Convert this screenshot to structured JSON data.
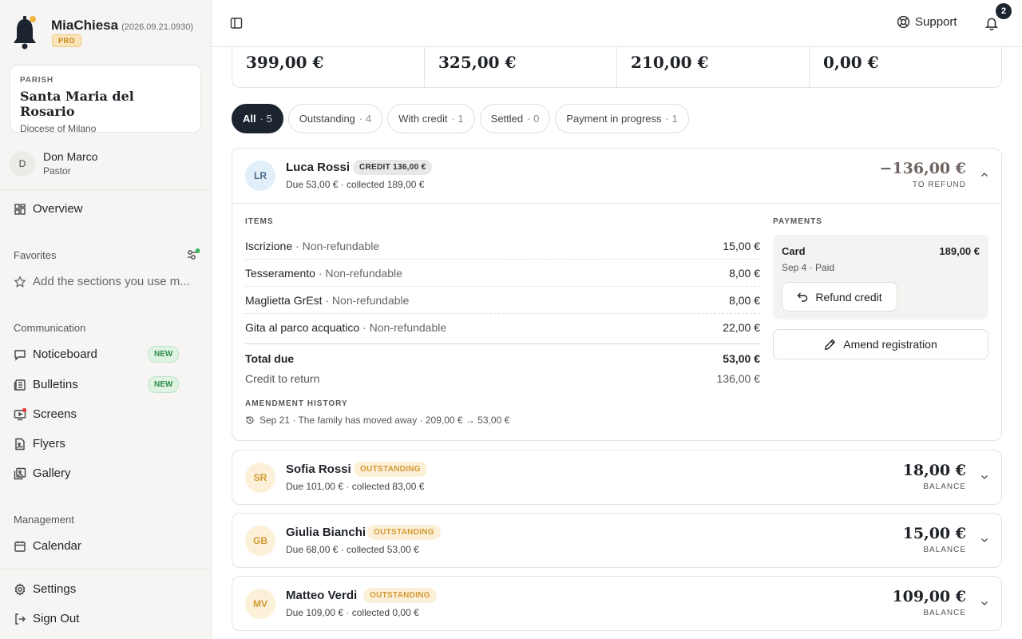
{
  "app": {
    "name": "MiaChiesa",
    "version": "(2026.09.21.0930)",
    "plan": "PRO"
  },
  "parish": {
    "label": "PARISH",
    "name": "Santa Maria del Rosario",
    "diocese": "Diocese of Milano"
  },
  "user": {
    "initial": "D",
    "name": "Don Marco",
    "role": "Pastor"
  },
  "nav": {
    "overview": "Overview",
    "favorites_title": "Favorites",
    "favorites_hint": "Add the sections you use m...",
    "communication_title": "Communication",
    "noticeboard": "Noticeboard",
    "bulletins": "Bulletins",
    "screens": "Screens",
    "flyers": "Flyers",
    "gallery": "Gallery",
    "new_badge": "NEW",
    "management_title": "Management",
    "calendar": "Calendar",
    "settings": "Settings",
    "sign_out": "Sign Out"
  },
  "topbar": {
    "support": "Support",
    "notifications": "2"
  },
  "summary": [
    "399,00 €",
    "325,00 €",
    "210,00 €",
    "0,00 €"
  ],
  "filters": [
    {
      "label": "All",
      "count": "· 5",
      "active": true
    },
    {
      "label": "Outstanding",
      "count": "· 4"
    },
    {
      "label": "With credit",
      "count": "· 1"
    },
    {
      "label": "Settled",
      "count": "· 0"
    },
    {
      "label": "Payment in progress",
      "count": "· 1"
    }
  ],
  "registrations": [
    {
      "initials": "LR",
      "name": "Luca Rossi",
      "tag": "CREDIT 136,00 €",
      "sub": "Due 53,00 € · collected 189,00 €",
      "amount": "−136,00 €",
      "amount_label": "TO REFUND",
      "items_label": "ITEMS",
      "items": [
        {
          "name": "Iscrizione",
          "note": "· Non-refundable",
          "price": "15,00 €"
        },
        {
          "name": "Tesseramento",
          "note": "· Non-refundable",
          "price": "8,00 €"
        },
        {
          "name": "Maglietta GrEst",
          "note": "· Non-refundable",
          "price": "8,00 €"
        },
        {
          "name": "Gita al parco acquatico",
          "note": "· Non-refundable",
          "price": "22,00 €"
        }
      ],
      "total_label": "Total due",
      "total": "53,00 €",
      "credit_label": "Credit to return",
      "credit": "136,00 €",
      "history_label": "AMENDMENT HISTORY",
      "history": "Sep 21 · The family has moved away · 209,00 € → 53,00 €",
      "payments_label": "PAYMENTS",
      "payment": {
        "method": "Card",
        "amount": "189,00 €",
        "meta": "Sep 4 · Paid"
      },
      "refund_button": "Refund credit",
      "amend_button": "Amend registration"
    },
    {
      "initials": "SR",
      "name": "Sofia Rossi",
      "tag": "OUTSTANDING",
      "sub": "Due 101,00 € · collected 83,00 €",
      "amount": "18,00 €",
      "amount_label": "BALANCE"
    },
    {
      "initials": "GB",
      "name": "Giulia Bianchi",
      "tag": "OUTSTANDING",
      "sub": "Due 68,00 € · collected 53,00 €",
      "amount": "15,00 €",
      "amount_label": "BALANCE"
    },
    {
      "initials": "MV",
      "name": "Matteo Verdi",
      "tag": "OUTSTANDING",
      "sub": "Due 109,00 € · collected 0,00 €",
      "amount": "109,00 €",
      "amount_label": "BALANCE"
    }
  ]
}
